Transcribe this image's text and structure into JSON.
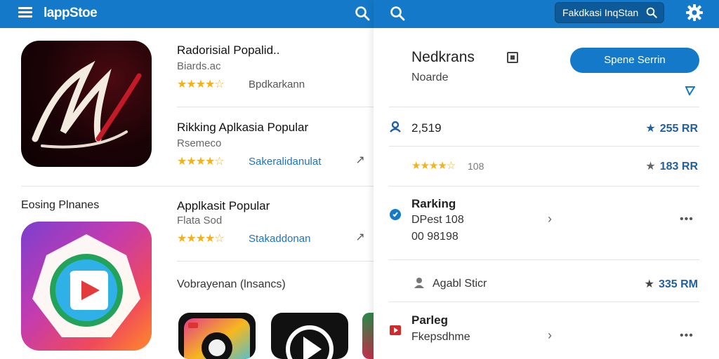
{
  "left": {
    "brand": "lappStoe",
    "apps": [
      {
        "title": "Radorisial Popalid..",
        "subtitle": "Biards.ac",
        "rating": "★★★★☆",
        "link": "Bpdkarkann"
      },
      {
        "title": "Rikking Aplkasia Popular",
        "subtitle": "Rsemeco",
        "rating": "★★★★☆",
        "link": "Sakeralidanulat"
      },
      {
        "title": "Applkasit Popular",
        "subtitle": "Flata Sod",
        "rating": "★★★★☆",
        "link": "Stakaddonan"
      }
    ],
    "section_label": "Eosing Plnanes",
    "section_label_2": "Vobrayenan (lnsancs)"
  },
  "right": {
    "search_pill": "Fakdkasi InqStan",
    "title": "Nedkrans",
    "subtitle": "Noarde",
    "primary_button": "Spene Serrin",
    "rows": [
      {
        "left": "2,519",
        "value": "255 RR"
      },
      {
        "stars": "★★★★☆",
        "count": "108",
        "value": "183 RR"
      },
      {
        "title": "Rarking",
        "line2": "DPest 108",
        "line3": "00 98198"
      },
      {
        "title": "Agabl Sticr",
        "value": "335 RM"
      },
      {
        "title": "Parleg",
        "line2": "Fkepsdhme"
      }
    ]
  },
  "colors": {
    "accent": "#1479c9",
    "star": "#f2b21b",
    "link": "#1f72c2",
    "value": "#1f5fa3"
  }
}
